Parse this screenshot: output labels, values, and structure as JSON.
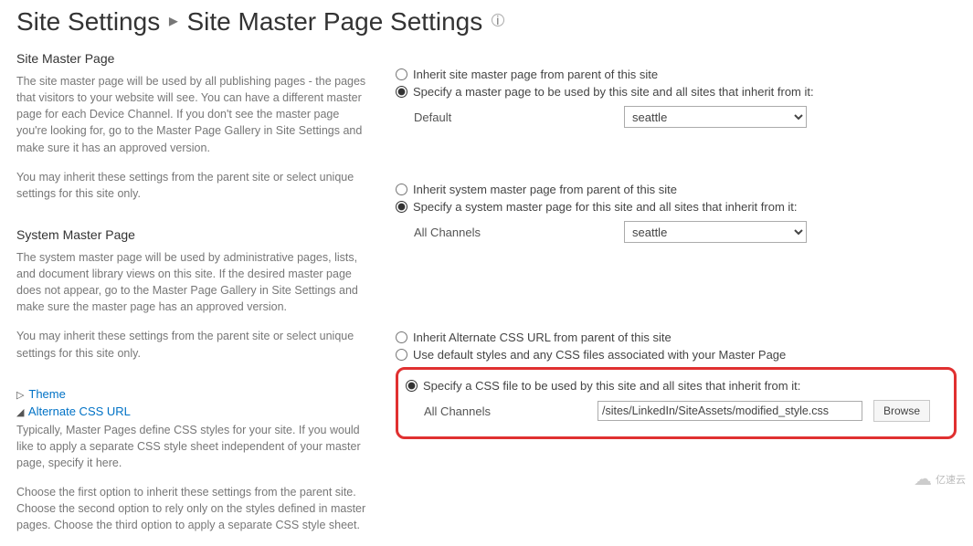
{
  "header": {
    "crumb1": "Site Settings",
    "crumb2": "Site Master Page Settings"
  },
  "left": {
    "siteMaster": {
      "title": "Site Master Page",
      "desc1": "The site master page will be used by all publishing pages - the pages that visitors to your website will see. You can have a different master page for each Device Channel. If you don't see the master page you're looking for, go to the Master Page Gallery in Site Settings and make sure it has an approved version.",
      "desc2": "You may inherit these settings from the parent site or select unique settings for this site only."
    },
    "systemMaster": {
      "title": "System Master Page",
      "desc1": "The system master page will be used by administrative pages, lists, and document library views on this site. If the desired master page does not appear, go to the Master Page Gallery in Site Settings and make sure the master page has an approved version.",
      "desc2": "You may inherit these settings from the parent site or select unique settings for this site only."
    },
    "theme": {
      "label": "Theme"
    },
    "altcss": {
      "label": "Alternate CSS URL",
      "desc1": "Typically, Master Pages define CSS styles for your site. If you would like to apply a separate CSS style sheet independent of your master page, specify it here.",
      "desc2": "Choose the first option to inherit these settings from the parent site. Choose the second option to rely only on the styles defined in master pages. Choose the third option to apply a separate CSS style sheet."
    }
  },
  "right": {
    "siteMaster": {
      "opt_inherit": "Inherit site master page from parent of this site",
      "opt_specify": "Specify a master page to be used by this site and all sites that inherit from it:",
      "channelLabel": "Default",
      "selectValue": "seattle"
    },
    "systemMaster": {
      "opt_inherit": "Inherit system master page from parent of this site",
      "opt_specify": "Specify a system master page for this site and all sites that inherit from it:",
      "channelLabel": "All Channels",
      "selectValue": "seattle"
    },
    "altcss": {
      "opt_inherit": "Inherit Alternate CSS URL from parent of this site",
      "opt_default": "Use default styles and any CSS files associated with your Master Page",
      "opt_specify": "Specify a CSS file to be used by this site and all sites that inherit from it:",
      "channelLabel": "All Channels",
      "textValue": "/sites/LinkedIn/SiteAssets/modified_style.css",
      "browse": "Browse"
    }
  },
  "watermark": "亿速云"
}
